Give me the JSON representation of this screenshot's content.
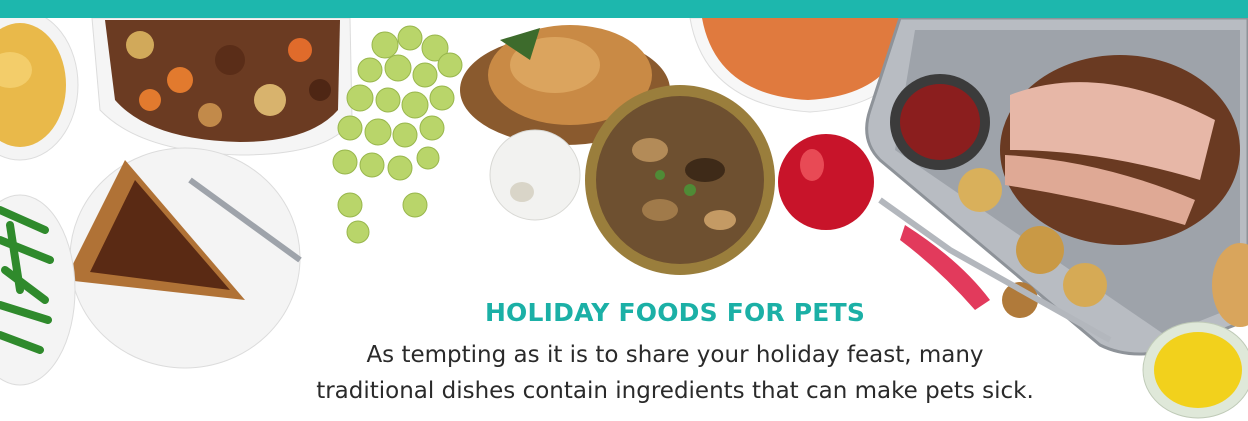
{
  "banner": {
    "accent_color": "#1db7ad",
    "title": "HOLIDAY FOODS FOR PETS",
    "body_line_1": "As tempting as it is to share your holiday feast, many",
    "body_line_2": "traditional dishes contain ingredients that can make pets sick."
  },
  "image": {
    "items": [
      "macaroni-and-cheese",
      "beef-stew",
      "green-grapes",
      "roast-chicken",
      "sweet-potato-mash",
      "roast-beef-tray",
      "mushrooms",
      "garlic",
      "red-apple",
      "ketchup",
      "pecan-pie",
      "green-beans",
      "mustard-sauce",
      "bread-roll"
    ]
  }
}
